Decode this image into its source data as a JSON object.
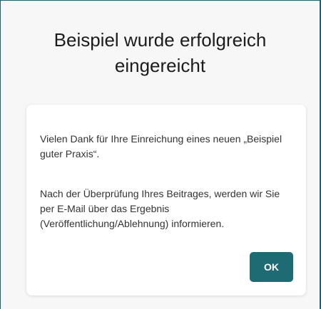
{
  "dialog": {
    "title": "Beispiel wurde erfolgreich eingereicht",
    "paragraph_1": "Vielen Dank für Ihre Einreichung eines neuen „Beispiel guter Praxis“.",
    "paragraph_2": "Nach der Überprüfung Ihres Beitrages, werden wir Sie per E-Mail über das Ergebnis (Veröffentlichung/Ablehnung) informieren.",
    "ok_label": "OK"
  },
  "colors": {
    "accent": "#1f6b74",
    "frame": "#1f5f73",
    "background": "#f7f7f7"
  }
}
